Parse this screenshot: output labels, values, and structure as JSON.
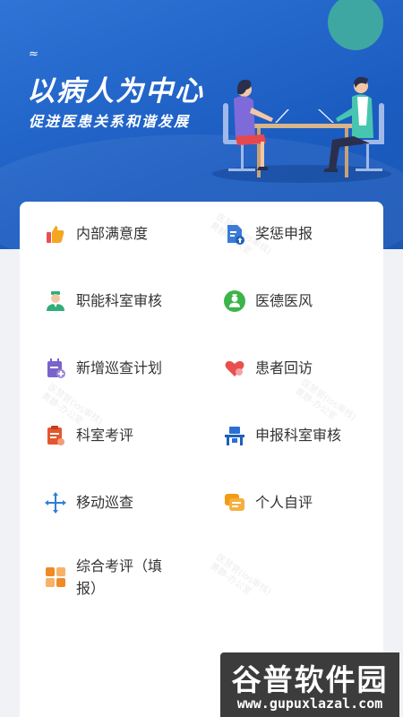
{
  "banner": {
    "deco": "≈",
    "title": "以病人为中心",
    "subtitle": "促进医患关系和谐发展"
  },
  "menu": [
    {
      "label": "内部满意度",
      "icon": "thumbs-up-icon",
      "color": "#f5a623"
    },
    {
      "label": "奖惩申报",
      "icon": "document-upload-icon",
      "color": "#3a7bd5"
    },
    {
      "label": "职能科室审核",
      "icon": "doctor-icon",
      "color": "#2fae7a"
    },
    {
      "label": "医德医风",
      "icon": "doctor-badge-icon",
      "color": "#3cb44a"
    },
    {
      "label": "新增巡查计划",
      "icon": "calendar-add-icon",
      "color": "#7a63c9"
    },
    {
      "label": "患者回访",
      "icon": "heart-icon",
      "color": "#e8504f"
    },
    {
      "label": "科室考评",
      "icon": "clipboard-icon",
      "color": "#e4572e"
    },
    {
      "label": "申报科室审核",
      "icon": "desk-icon",
      "color": "#2b6fd6"
    },
    {
      "label": "移动巡查",
      "icon": "move-arrows-icon",
      "color": "#2b7fd6"
    },
    {
      "label": "个人自评",
      "icon": "chat-icon",
      "color": "#f39c12"
    },
    {
      "label": "综合考评（填报）",
      "icon": "grid-icon",
      "color": "#f08a24"
    }
  ],
  "watermark": {
    "line1": "医慧管(ios审核)",
    "line2": "黄静-办公室"
  },
  "site_logo": {
    "name": "谷普软件园",
    "url": "www.gupuxlazal.com"
  }
}
